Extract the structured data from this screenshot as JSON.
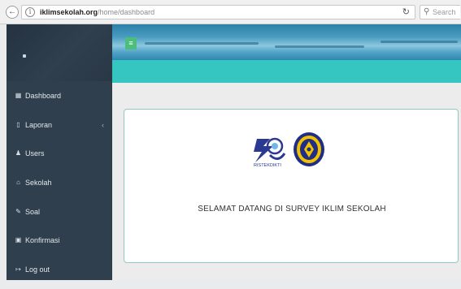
{
  "browser": {
    "url_host": "iklimsekolah.org",
    "url_path": "/home/dashboard",
    "search_placeholder": "Search",
    "icons": {
      "back": "back-arrow-icon",
      "info": "info-icon",
      "reload": "reload-icon",
      "search": "search-icon"
    }
  },
  "sidebar": {
    "items": [
      {
        "label": "Dashboard",
        "icon": "dashboard-grid-icon",
        "glyph": "▦"
      },
      {
        "label": "Laporan",
        "icon": "document-icon",
        "glyph": "▯",
        "has_submenu": true,
        "chevron": "‹"
      },
      {
        "label": "Users",
        "icon": "user-icon",
        "glyph": "♟"
      },
      {
        "label": "Sekolah",
        "icon": "school-building-icon",
        "glyph": "⌂"
      },
      {
        "label": "Soal",
        "icon": "edit-pencil-icon",
        "glyph": "✎"
      },
      {
        "label": "Konfirmasi",
        "icon": "confirm-check-icon",
        "glyph": "▣"
      },
      {
        "label": "Log out",
        "icon": "logout-icon",
        "glyph": "↦"
      }
    ]
  },
  "header": {
    "menu_toggle_icon": "menu-toggle-icon",
    "menu_glyph": "≡"
  },
  "main": {
    "welcome_text": "SELAMAT DATANG DI SURVEY IKLIM SEKOLAH",
    "logos": [
      {
        "name": "ristekdikti-logo",
        "text": "RISTEKDIKTI"
      },
      {
        "name": "uny-logo"
      }
    ]
  },
  "colors": {
    "sidebar": "#2f3f4d",
    "teal_band": "#35c6c1",
    "menu_button": "#4cbd7a",
    "card_border": "#8fc9c2"
  }
}
